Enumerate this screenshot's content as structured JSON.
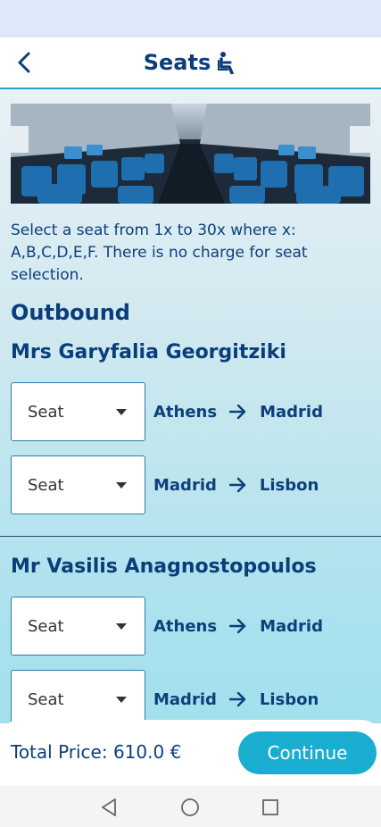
{
  "header": {
    "title": "Seats",
    "back_icon": "chevron-left-icon",
    "title_icon": "seat-icon"
  },
  "info_text": "Select a seat from 1x to 30x where x: A,B,C,D,E,F. There is no charge for seat selection.",
  "section_title": "Outbound",
  "passengers": [
    {
      "name": "Mrs Garyfalia Georgitziki",
      "flights": [
        {
          "seat_placeholder": "Seat",
          "from": "Athens",
          "to": "Madrid"
        },
        {
          "seat_placeholder": "Seat",
          "from": "Madrid",
          "to": "Lisbon"
        }
      ]
    },
    {
      "name": "Mr Vasilis Anagnostopoulos",
      "flights": [
        {
          "seat_placeholder": "Seat",
          "from": "Athens",
          "to": "Madrid"
        },
        {
          "seat_placeholder": "Seat",
          "from": "Madrid",
          "to": "Lisbon"
        }
      ]
    }
  ],
  "footer": {
    "total_price": "Total Price: 610.0 €",
    "continue_label": "Continue"
  },
  "colors": {
    "primary_text": "#0a3d7a",
    "accent": "#19aed0",
    "header_border": "#2aa2bb"
  }
}
